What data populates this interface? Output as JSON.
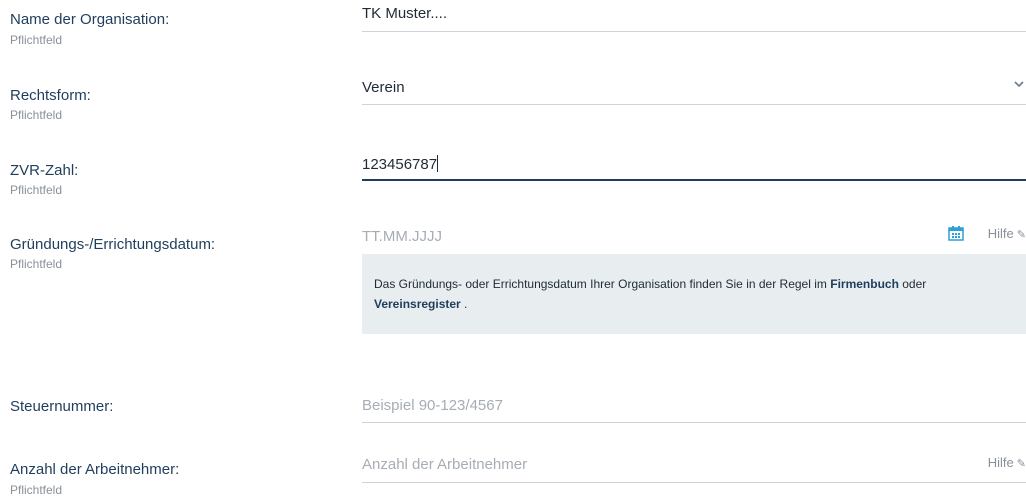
{
  "fields": {
    "organisation": {
      "label": "Name der Organisation:",
      "sub": "Pflichtfeld",
      "value": "TK Muster...."
    },
    "rechtsform": {
      "label": "Rechtsform:",
      "sub": "Pflichtfeld",
      "value": "Verein"
    },
    "zvr": {
      "label": "ZVR-Zahl:",
      "sub": "Pflichtfeld",
      "value": "123456787"
    },
    "datum": {
      "label": "Gründungs-/Errichtungsdatum:",
      "sub": "Pflichtfeld",
      "placeholder": "TT.MM.JJJJ",
      "help": "Hilfe"
    },
    "steuer": {
      "label": "Steuernummer:",
      "placeholder": "Beispiel 90-123/4567"
    },
    "arbeitnehmer": {
      "label": "Anzahl der Arbeitnehmer:",
      "sub": "Pflichtfeld",
      "placeholder": "Anzahl der Arbeitnehmer",
      "help": "Hilfe"
    }
  },
  "info": {
    "text1": "Das Gründungs- oder Errichtungsdatum Ihrer Organisation finden Sie in der Regel im ",
    "link1": "Firmenbuch",
    "text2": " oder ",
    "link2": "Vereinsregister",
    "text3": " ."
  },
  "icons": {
    "chevron": "chevron-down-icon",
    "calendar": "calendar-icon",
    "pencil": "pencil-icon"
  },
  "colors": {
    "label": "#1f3d5c",
    "accent": "#2a9fd8",
    "info_bg": "#e8edf0"
  }
}
